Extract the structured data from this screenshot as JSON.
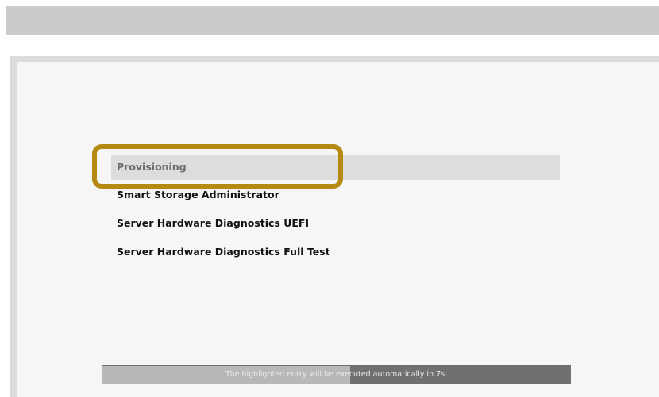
{
  "boot_menu": {
    "entries": [
      {
        "label": "Provisioning",
        "selected": true
      },
      {
        "label": "Smart Storage Administrator",
        "selected": false
      },
      {
        "label": "Server Hardware Diagnostics UEFI",
        "selected": false
      },
      {
        "label": "Server Hardware Diagnostics Full Test",
        "selected": false
      }
    ]
  },
  "timeout": {
    "message": "The highlighted entry will be executed automatically in 7s.",
    "seconds_remaining": 7,
    "elapsed_fraction": 0.53
  },
  "colors": {
    "selection_bg": "#dddddd",
    "highlight_ring": "#b58a12",
    "panel_bg": "#f6f6f6",
    "top_bar": "#cbcbcb"
  }
}
